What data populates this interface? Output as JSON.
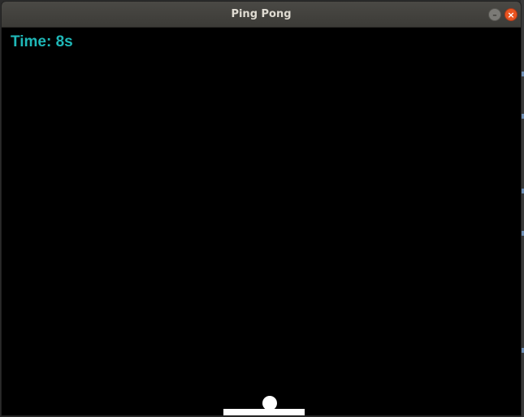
{
  "window": {
    "title": "Ping Pong",
    "minimize_glyph": "–",
    "close_glyph": "×"
  },
  "hud": {
    "time_text": "Time: 8s"
  },
  "game": {
    "elapsed_seconds": 8
  },
  "colors": {
    "titlebar": "#3c3b37",
    "close_button": "#e95420",
    "background": "#000000",
    "time_text": "#1fb8b8",
    "ball": "#ffffff",
    "paddle": "#ffffff"
  },
  "icons": {
    "minimize": "minimize-icon",
    "close": "close-icon"
  }
}
